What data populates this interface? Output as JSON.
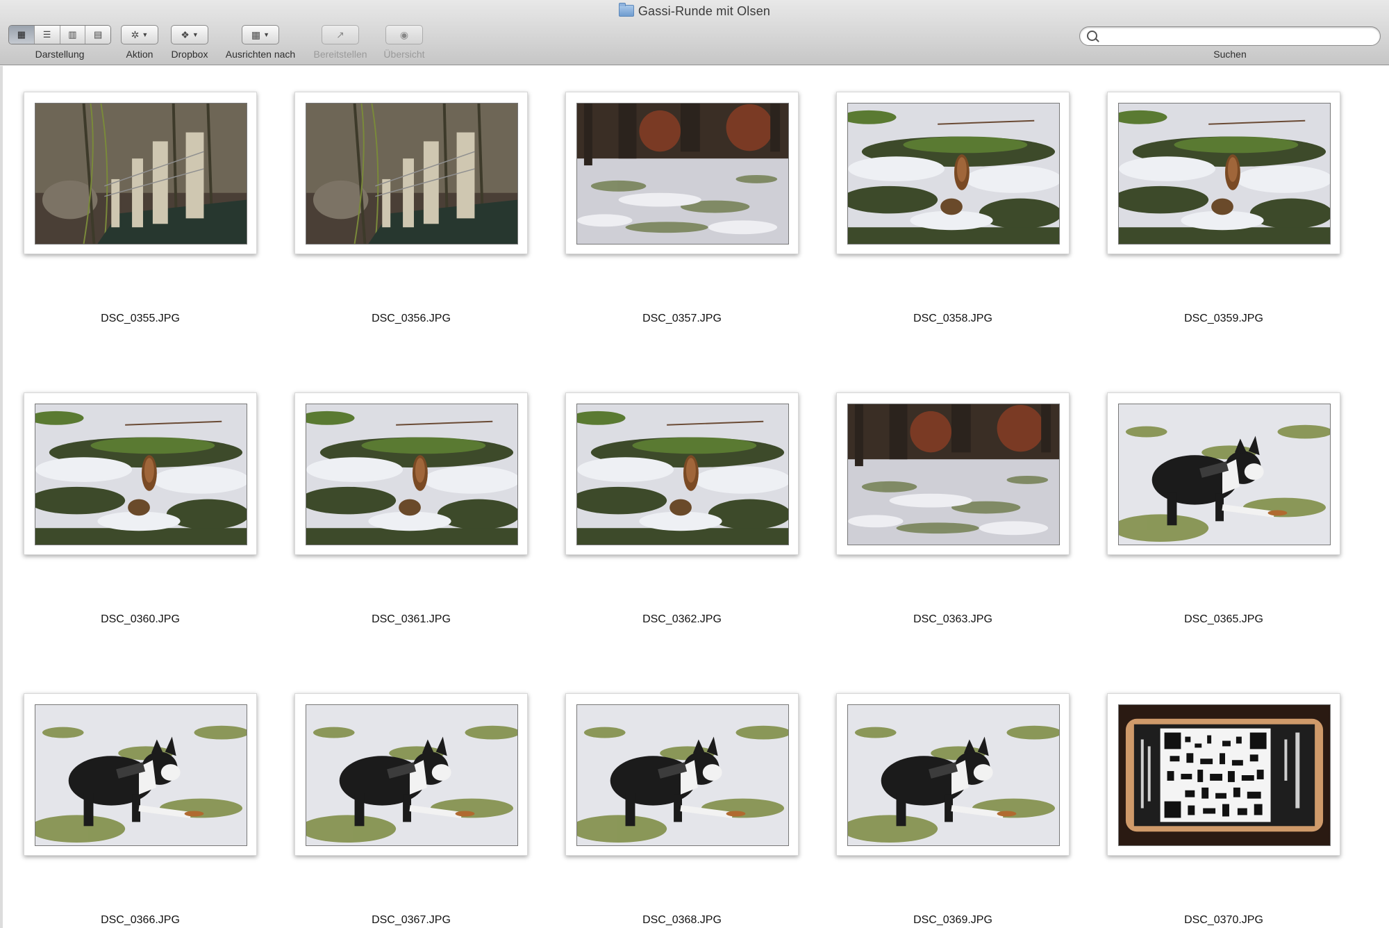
{
  "window": {
    "title": "Gassi-Runde mit Olsen"
  },
  "toolbar": {
    "view_label": "Darstellung",
    "action_label": "Aktion",
    "dropbox_label": "Dropbox",
    "arrange_label": "Ausrichten nach",
    "share_label": "Bereitstellen",
    "quicklook_label": "Übersicht",
    "search_label": "Suchen",
    "search_value": ""
  },
  "files": [
    {
      "name": "DSC_0355.JPG",
      "scene": "fence"
    },
    {
      "name": "DSC_0356.JPG",
      "scene": "fence"
    },
    {
      "name": "DSC_0357.JPG",
      "scene": "forest"
    },
    {
      "name": "DSC_0358.JPG",
      "scene": "cone"
    },
    {
      "name": "DSC_0359.JPG",
      "scene": "cone"
    },
    {
      "name": "DSC_0360.JPG",
      "scene": "cone"
    },
    {
      "name": "DSC_0361.JPG",
      "scene": "cone"
    },
    {
      "name": "DSC_0362.JPG",
      "scene": "cone"
    },
    {
      "name": "DSC_0363.JPG",
      "scene": "forest"
    },
    {
      "name": "DSC_0365.JPG",
      "scene": "dog"
    },
    {
      "name": "DSC_0366.JPG",
      "scene": "dog"
    },
    {
      "name": "DSC_0367.JPG",
      "scene": "dog"
    },
    {
      "name": "DSC_0368.JPG",
      "scene": "dog"
    },
    {
      "name": "DSC_0369.JPG",
      "scene": "dog"
    },
    {
      "name": "DSC_0370.JPG",
      "scene": "qr"
    }
  ]
}
